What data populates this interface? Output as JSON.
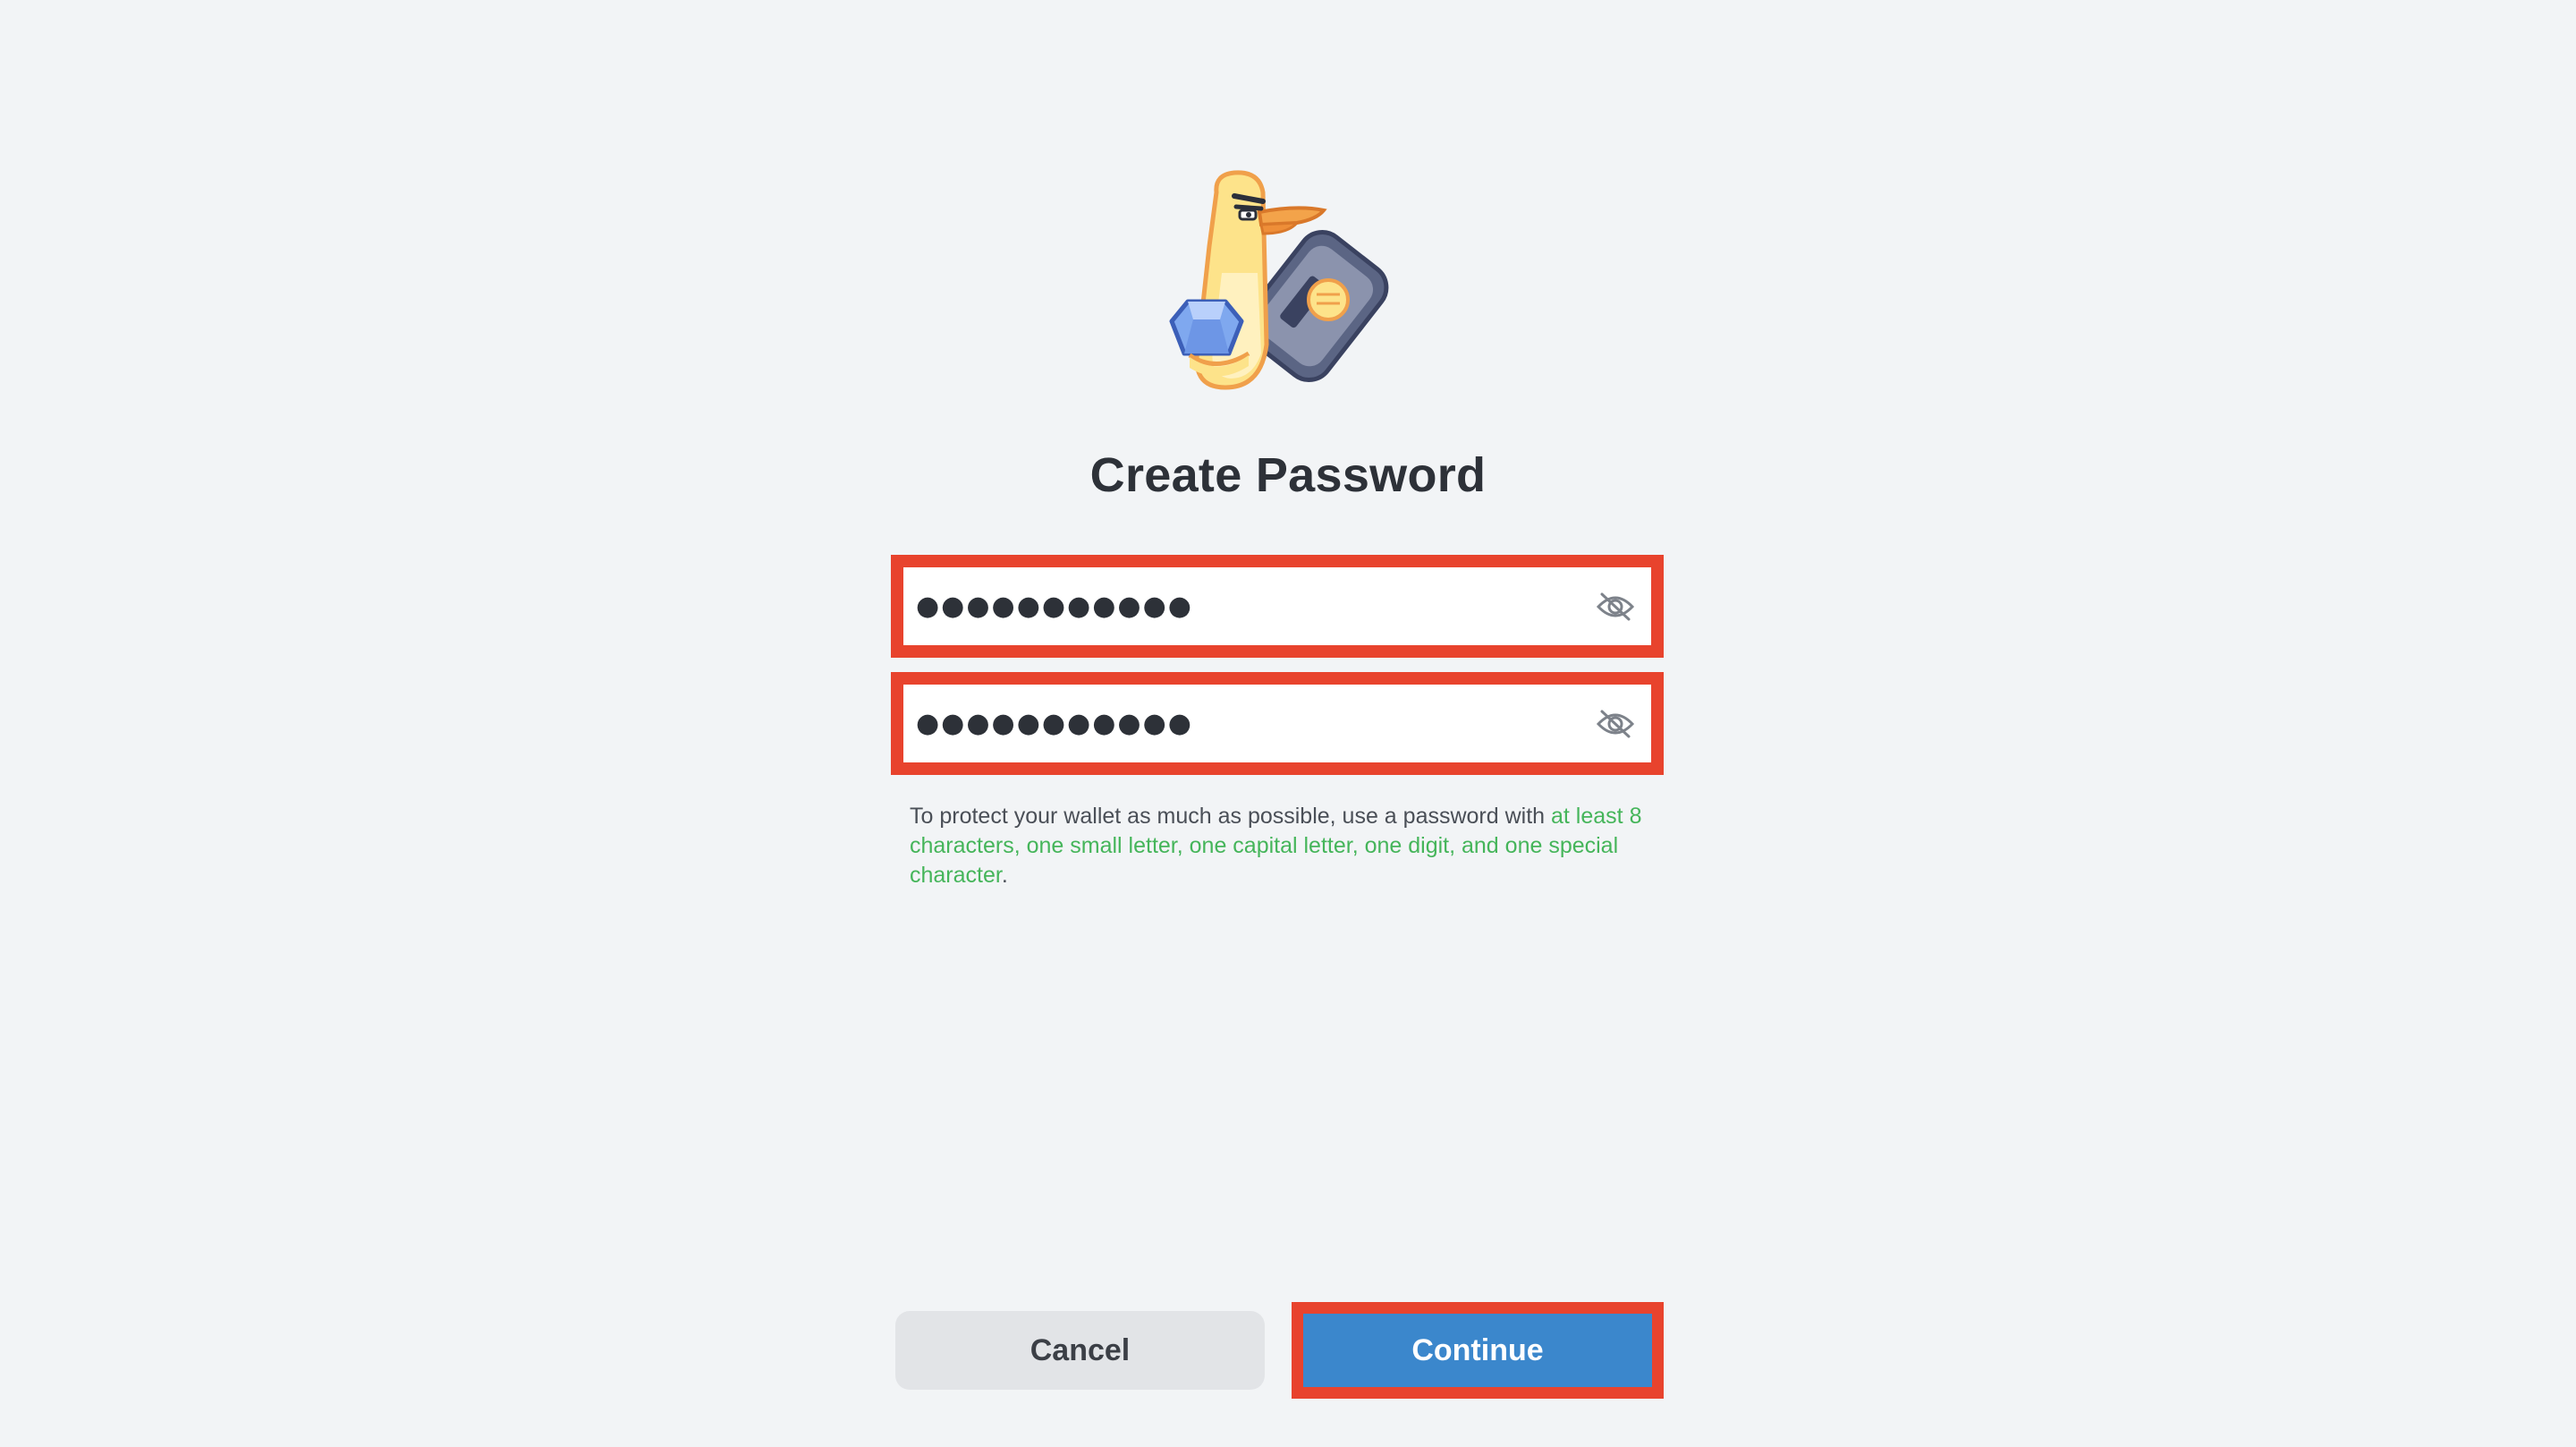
{
  "title": "Create Password",
  "password_field": {
    "value": "●●●●●●●●●●●",
    "toggle_icon": "eye-off-icon"
  },
  "confirm_field": {
    "value": "●●●●●●●●●●●",
    "toggle_icon": "eye-off-icon"
  },
  "hint": {
    "prefix": "To protect your wallet as much as possible, use a password with ",
    "highlight": "at least 8 characters, one small letter, one capital letter, one digit, and one special character",
    "suffix": "."
  },
  "buttons": {
    "cancel": "Cancel",
    "continue": "Continue"
  },
  "colors": {
    "background": "#f2f4f6",
    "highlight_frame": "#e8432d",
    "primary": "#3b87cc",
    "hint_green": "#45b55a"
  }
}
